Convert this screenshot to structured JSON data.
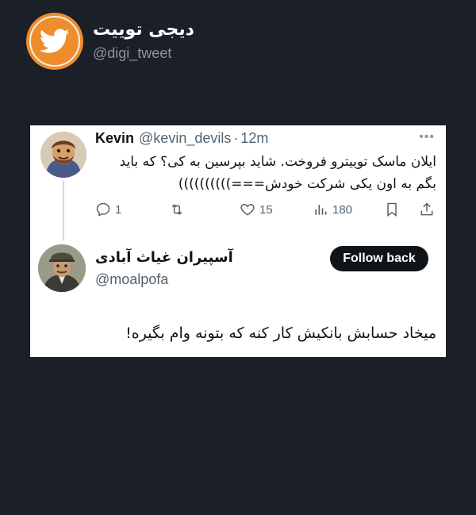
{
  "brand": {
    "name": "دیجی توییت",
    "handle": "@digi_tweet",
    "accent": "#ef8d2c"
  },
  "tweet1": {
    "author_name": "Kevin",
    "author_handle": "@kevin_devils",
    "separator": "·",
    "time": "12m",
    "text_line1": "ایلان ماسک توییترو فروخت. شاید بپرسین به کی؟ که باید",
    "text_line2": "بگم به اون یکی شرکت خودش===))))))))))",
    "more_icon": "more-dots-icon",
    "actions": {
      "reply_count": "1",
      "retweet_count": "",
      "like_count": "15",
      "view_count": "180"
    }
  },
  "tweet2": {
    "author_name": "آسپیران غیاث آبادی",
    "author_handle": "@moalpofa",
    "follow_label": "Follow back",
    "text": "میخاد حسابش بانکیش کار کنه که بتونه وام بگیره!"
  },
  "colors": {
    "background": "#1a1f28",
    "card": "#ffffff",
    "text_primary": "#0f1419",
    "text_secondary": "#536471",
    "button": "#0f1419"
  }
}
